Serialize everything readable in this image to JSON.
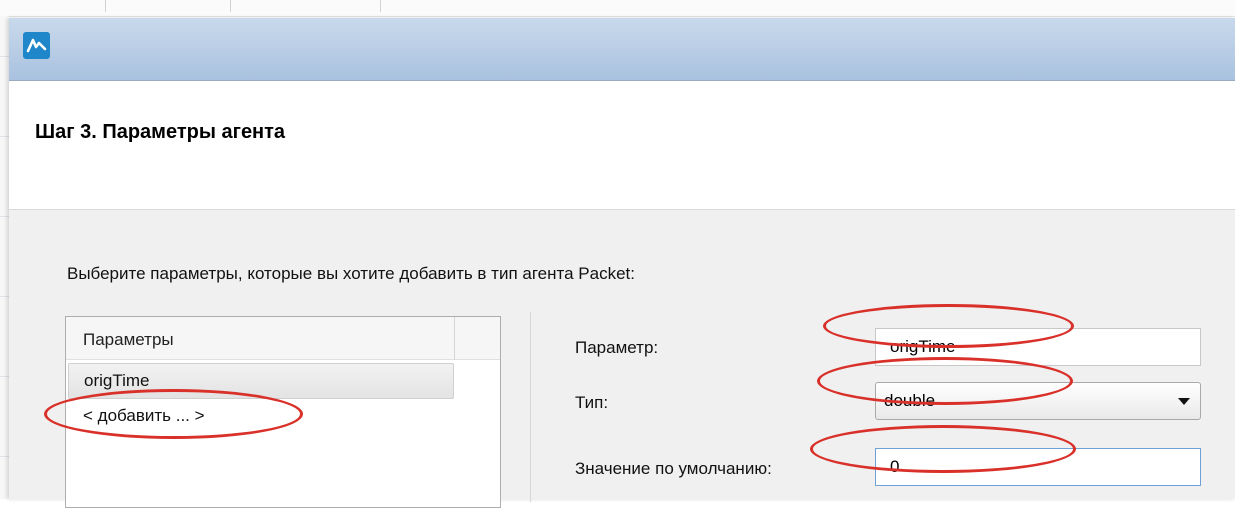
{
  "dialog": {
    "step_title": "Шаг 3. Параметры агента",
    "instruction": "Выберите параметры, которые вы хотите добавить в тип агента Packet:"
  },
  "parameter_list": {
    "header": "Параметры",
    "items": [
      {
        "label": "origTime"
      },
      {
        "label": "< добавить ... >"
      }
    ]
  },
  "form": {
    "parameter_label": "Параметр:",
    "parameter_value": "origTime",
    "type_label": "Тип:",
    "type_value": "double",
    "default_label": "Значение по умолчанию:",
    "default_value": "0"
  },
  "colors": {
    "highlight": "#d9302a",
    "titlebar": "#b8cde5",
    "app_icon": "#1e86c9"
  }
}
